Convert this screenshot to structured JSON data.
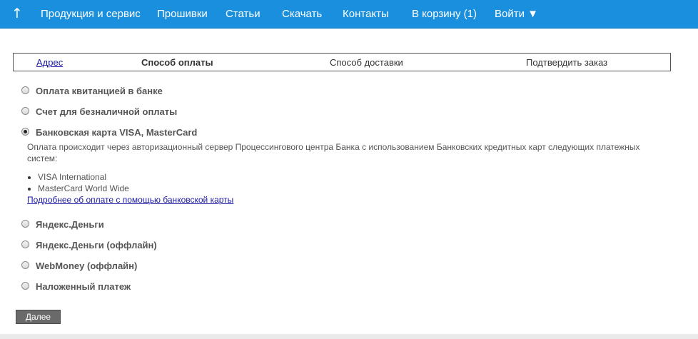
{
  "nav": {
    "up_icon": "↑",
    "items": [
      {
        "label": "Продукция и сервис"
      },
      {
        "label": "Прошивки"
      },
      {
        "label": "Статьи"
      },
      {
        "label": "Скачать"
      },
      {
        "label": "Контакты"
      },
      {
        "label": "В корзину (1)"
      },
      {
        "label": "Войти ▼"
      }
    ]
  },
  "steps": {
    "address": "Адрес",
    "payment": "Способ оплаты",
    "delivery": "Способ доставки",
    "confirm": "Подтвердить заказ"
  },
  "payment_options": [
    {
      "label": "Оплата квитанцией в банке",
      "selected": false
    },
    {
      "label": "Счет для безналичной оплаты",
      "selected": false
    },
    {
      "label": "Банковская карта VISA, MasterCard",
      "selected": true
    },
    {
      "label": "Яндекс.Деньги",
      "selected": false
    },
    {
      "label": "Яндекс.Деньги (оффлайн)",
      "selected": false
    },
    {
      "label": "WebMoney (оффлайн)",
      "selected": false
    },
    {
      "label": "Наложенный платеж",
      "selected": false
    }
  ],
  "card_info": {
    "description": "Оплата происходит через авторизационный сервер Процессингового центра Банка с использованием Банковских кредитных карт следующих платежных систем:",
    "systems": [
      "VISA International",
      "MasterCard World Wide"
    ],
    "more_link": "Подробнее об оплате с помощью банковской карты"
  },
  "next_button": "Далее",
  "colors": {
    "nav_bg": "#1a8fde",
    "link": "#1a1aa6",
    "button_bg": "#6a6a6a"
  }
}
